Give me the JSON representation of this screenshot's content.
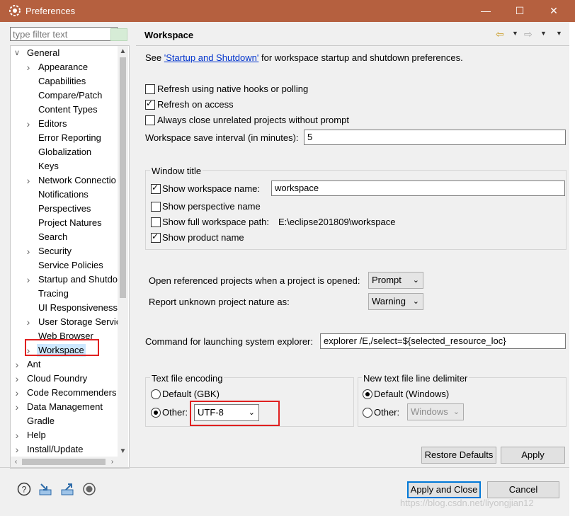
{
  "window": {
    "title": "Preferences",
    "minimize": "—",
    "maximize": "☐",
    "close": "✕"
  },
  "filter": {
    "placeholder": "type filter text"
  },
  "tree": {
    "items": [
      {
        "label": "General",
        "level": 0,
        "expanded": true
      },
      {
        "label": "Appearance",
        "level": 1,
        "expandable": true
      },
      {
        "label": "Capabilities",
        "level": 1
      },
      {
        "label": "Compare/Patch",
        "level": 1
      },
      {
        "label": "Content Types",
        "level": 1
      },
      {
        "label": "Editors",
        "level": 1,
        "expandable": true
      },
      {
        "label": "Error Reporting",
        "level": 1
      },
      {
        "label": "Globalization",
        "level": 1
      },
      {
        "label": "Keys",
        "level": 1
      },
      {
        "label": "Network Connectio",
        "level": 1,
        "expandable": true
      },
      {
        "label": "Notifications",
        "level": 1
      },
      {
        "label": "Perspectives",
        "level": 1
      },
      {
        "label": "Project Natures",
        "level": 1
      },
      {
        "label": "Search",
        "level": 1
      },
      {
        "label": "Security",
        "level": 1,
        "expandable": true
      },
      {
        "label": "Service Policies",
        "level": 1
      },
      {
        "label": "Startup and Shutdo",
        "level": 1,
        "expandable": true
      },
      {
        "label": "Tracing",
        "level": 1
      },
      {
        "label": "UI Responsiveness",
        "level": 1
      },
      {
        "label": "User Storage Servic",
        "level": 1,
        "expandable": true
      },
      {
        "label": "Web Browser",
        "level": 1
      },
      {
        "label": "Workspace",
        "level": 1,
        "expandable": true,
        "selected": true
      },
      {
        "label": "Ant",
        "level": 0,
        "expandable": true
      },
      {
        "label": "Cloud Foundry",
        "level": 0,
        "expandable": true
      },
      {
        "label": "Code Recommenders",
        "level": 0,
        "expandable": true
      },
      {
        "label": "Data Management",
        "level": 0,
        "expandable": true
      },
      {
        "label": "Gradle",
        "level": 0
      },
      {
        "label": "Help",
        "level": 0,
        "expandable": true
      },
      {
        "label": "Install/Update",
        "level": 0,
        "expandable": true
      }
    ]
  },
  "page": {
    "title": "Workspace",
    "intro_before": "See ",
    "intro_link": "'Startup and Shutdown'",
    "intro_after": " for workspace startup and shutdown preferences.",
    "refresh_native": {
      "label": "Refresh using native hooks or polling",
      "checked": false
    },
    "refresh_access": {
      "label": "Refresh on access",
      "checked": true
    },
    "always_close": {
      "label": "Always close unrelated projects without prompt",
      "checked": false
    },
    "save_interval": {
      "label": "Workspace save interval (in minutes):",
      "value": "5"
    },
    "window_title": {
      "legend": "Window title",
      "show_name": {
        "label": "Show workspace name:",
        "checked": true,
        "value": "workspace"
      },
      "show_perspective": {
        "label": "Show perspective name",
        "checked": false
      },
      "show_path": {
        "label": "Show full workspace path:",
        "checked": false,
        "value": "E:\\eclipse201809\\workspace"
      },
      "show_product": {
        "label": "Show product name",
        "checked": true
      }
    },
    "open_referenced": {
      "label": "Open referenced projects when a project is opened:",
      "value": "Prompt"
    },
    "report_unknown": {
      "label": "Report unknown project nature as:",
      "value": "Warning"
    },
    "explorer_cmd": {
      "label": "Command for launching system explorer:",
      "value": "explorer /E,/select=${selected_resource_loc}"
    },
    "encoding": {
      "legend": "Text file encoding",
      "default_label": "Default (GBK)",
      "default_selected": false,
      "other_label": "Other:",
      "other_selected": true,
      "other_value": "UTF-8"
    },
    "line_delimiter": {
      "legend": "New text file line delimiter",
      "default_label": "Default (Windows)",
      "default_selected": true,
      "other_label": "Other:",
      "other_selected": false,
      "other_value": "Windows"
    },
    "restore_defaults": "Restore Defaults",
    "apply": "Apply"
  },
  "footer": {
    "apply_close": "Apply and Close",
    "cancel": "Cancel",
    "icons": [
      "help-icon",
      "import-icon",
      "export-icon",
      "record-icon"
    ]
  },
  "watermark": "https://blog.csdn.net/liyongjian12",
  "colors": {
    "titlebar": "#b5603f",
    "highlight_box": "#e02020",
    "selection": "#cce8ff",
    "link": "#0033cc"
  }
}
